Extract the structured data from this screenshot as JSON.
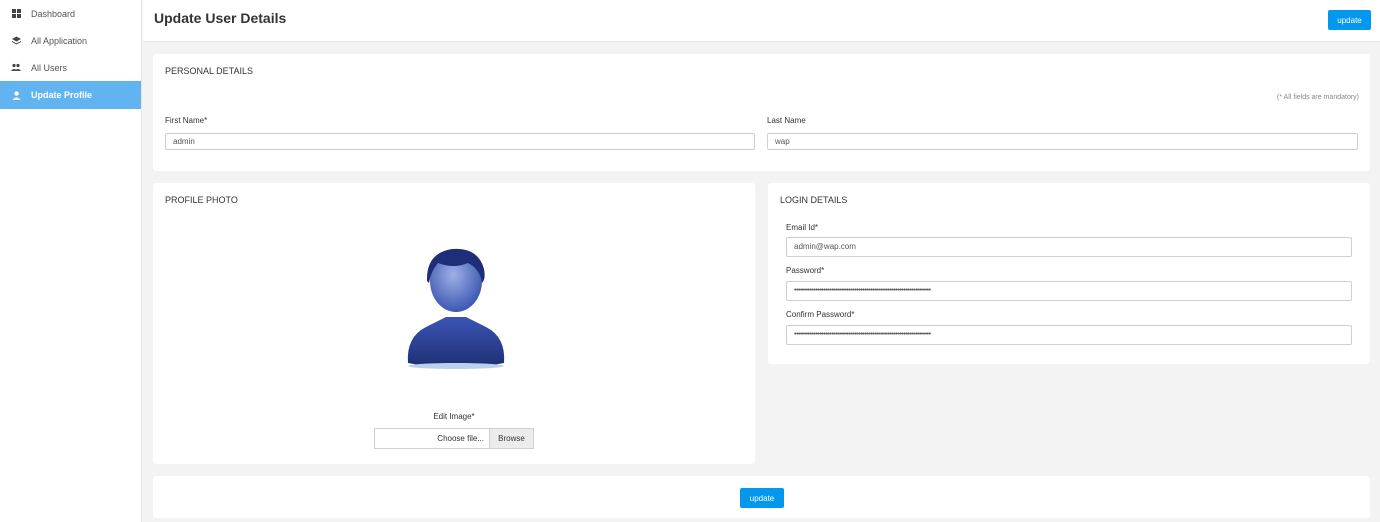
{
  "sidebar": {
    "items": [
      {
        "label": "Dashboard",
        "icon": "dashboard-icon"
      },
      {
        "label": "All Application",
        "icon": "layers-icon"
      },
      {
        "label": "All Users",
        "icon": "users-icon"
      },
      {
        "label": "Update Profile",
        "icon": "user-icon"
      }
    ],
    "active_index": 3
  },
  "header": {
    "title": "Update User Details",
    "update_label": "update"
  },
  "personal": {
    "title": "PERSONAL DETAILS",
    "note": "(* All fields are mandatory)",
    "first_name_label": "First Name*",
    "first_name_value": "admin",
    "last_name_label": "Last Name",
    "last_name_value": "wap"
  },
  "photo": {
    "title": "PROFILE PHOTO",
    "edit_label": "Edit Image*",
    "file_text": "Choose file...",
    "browse_label": "Browse"
  },
  "login": {
    "title": "LOGIN DETAILS",
    "email_label": "Email Id*",
    "email_value": "admin@wap.com",
    "password_label": "Password*",
    "password_value": "••••••••••••••••••••••••••••••••••••••••••••••••••••••••••••••••••••••",
    "confirm_label": "Confirm Password*",
    "confirm_value": "••••••••••••••••••••••••••••••••••••••••••••••••••••••••••••••••••••••"
  },
  "footer": {
    "update_label": "update"
  },
  "colors": {
    "accent": "#0497ee",
    "active_nav": "#62b4f0",
    "background": "#f3f3f3"
  }
}
